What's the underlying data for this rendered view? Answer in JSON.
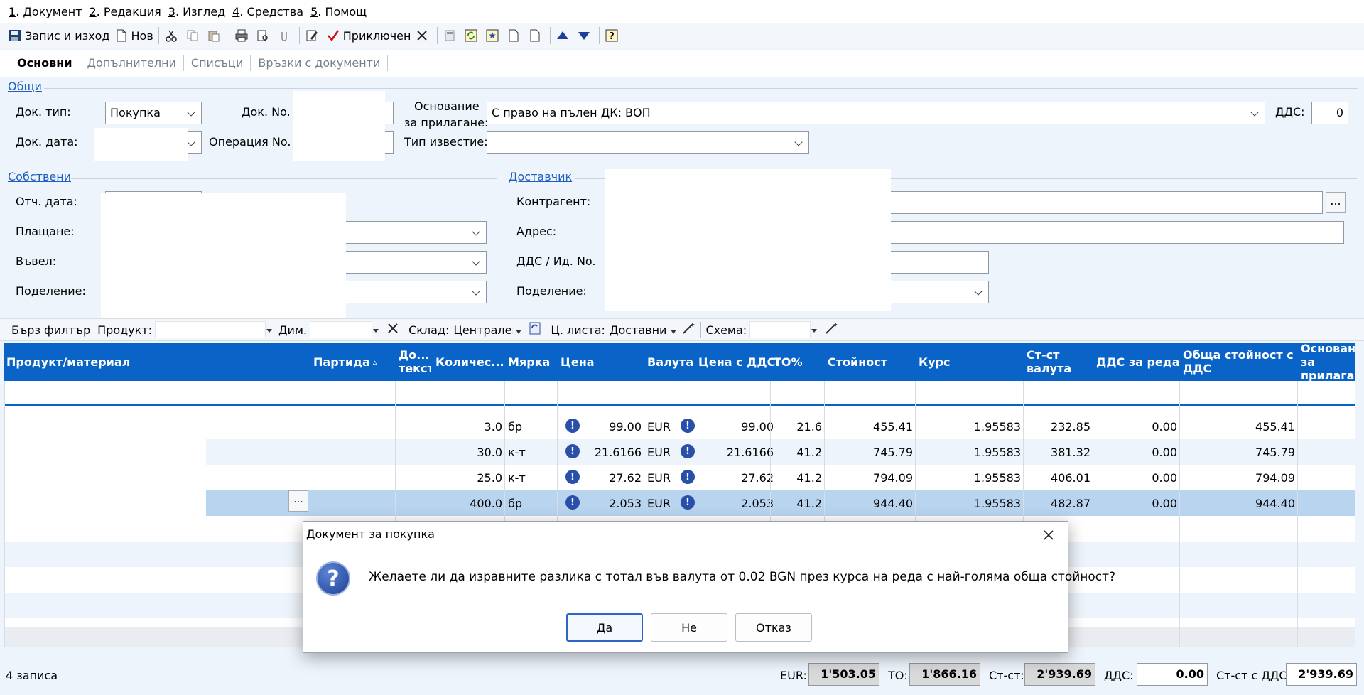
{
  "menu": [
    {
      "key": "1",
      "label": ". Документ"
    },
    {
      "key": "2",
      "label": ". Редакция"
    },
    {
      "key": "3",
      "label": ". Изглед"
    },
    {
      "key": "4",
      "label": ". Средства"
    },
    {
      "key": "5",
      "label": ". Помощ"
    }
  ],
  "toolbar": {
    "save_exit": "Запис и изход",
    "new": "Нов",
    "finished": "Приключен"
  },
  "tabs": [
    "Основни",
    "Допълнителни",
    "Списъци",
    "Връзки с документи"
  ],
  "sections": {
    "general": "Общи",
    "own": "Собствени",
    "supplier": "Доставчик"
  },
  "general": {
    "doc_type_label": "Док. тип:",
    "doc_type_value": "Покупка",
    "doc_no_label": "Док. No.",
    "doc_date_label": "Док. дата:",
    "op_no_label": "Операция No.",
    "basis_label_1": "Основание",
    "basis_label_2": "за прилагане:",
    "basis_value": "С право на пълен ДК: ВОП",
    "notice_type_label": "Тип известие:",
    "vat_label": "ДДС:",
    "vat_value": "0"
  },
  "own": {
    "rep_date_label": "Отч. дата:",
    "payment_label": "Плащане:",
    "entered_label": "Въвел:",
    "division_label": "Поделение:"
  },
  "supplier": {
    "counterparty_label": "Контрагент:",
    "address_label": "Адрес:",
    "vat_id_label": "ДДС / Ид. No.",
    "division_label": "Поделение:",
    "dots": "..."
  },
  "filter": {
    "quick_filter": "Бърз филтър",
    "product": "Продукт:",
    "dim": "Дим.",
    "warehouse": "Склад:",
    "warehouse_value": "Централен",
    "price_list": "Ц. листа:",
    "price_list_value": "Доставни",
    "scheme": "Схема:"
  },
  "grid": {
    "headers": [
      "Продукт/материал",
      "Партида",
      "До... текст",
      "Количес...",
      "Мярка",
      "Цена",
      "Валута",
      "Цена с ДДС",
      "ТО%",
      "Стойност",
      "Курс",
      "Ст-ст валута",
      "ДДС за реда",
      "Обща стойност с ДДС",
      "Основание за прилагане"
    ],
    "sort_mark": "▵",
    "rows": [
      {
        "qty": "3.0",
        "unit": "бр",
        "price": "99.00",
        "currency": "EUR",
        "price_vat": "99.00",
        "to": "21.6",
        "value": "455.41",
        "rate": "1.95583",
        "value_cur": "232.85",
        "vat_row": "0.00",
        "total": "455.41"
      },
      {
        "qty": "30.0",
        "unit": "к-т",
        "price": "21.6166",
        "currency": "EUR",
        "price_vat": "21.6166",
        "to": "41.2",
        "value": "745.79",
        "rate": "1.95583",
        "value_cur": "381.32",
        "vat_row": "0.00",
        "total": "745.79"
      },
      {
        "qty": "25.0",
        "unit": "к-т",
        "price": "27.62",
        "currency": "EUR",
        "price_vat": "27.62",
        "to": "41.2",
        "value": "794.09",
        "rate": "1.95583",
        "value_cur": "406.01",
        "vat_row": "0.00",
        "total": "794.09"
      },
      {
        "qty": "400.0",
        "unit": "бр",
        "price": "2.053",
        "currency": "EUR",
        "price_vat": "2.053",
        "to": "41.2",
        "value": "944.40",
        "rate": "1.95583",
        "value_cur": "482.87",
        "vat_row": "0.00",
        "total": "944.40"
      }
    ],
    "row_dots": "..."
  },
  "status": {
    "records": "4 записа",
    "eur_label": "EUR:",
    "eur_value": "1'503.05",
    "to_label": "ТО:",
    "to_value": "1'866.16",
    "cost_label": "Ст-ст:",
    "cost_value": "2'939.69",
    "vat_label": "ДДС:",
    "vat_value": "0.00",
    "cost_vat_label": "Ст-ст с ДДС:",
    "cost_vat_value": "2'939.69"
  },
  "dialog": {
    "title": "Документ за покупка",
    "message": "Желаете ли да изравните разлика с тотал във валута от 0.02 BGN през курса на реда с най-голяма обща стойност?",
    "yes": "Да",
    "no": "Не",
    "cancel": "Отказ"
  }
}
